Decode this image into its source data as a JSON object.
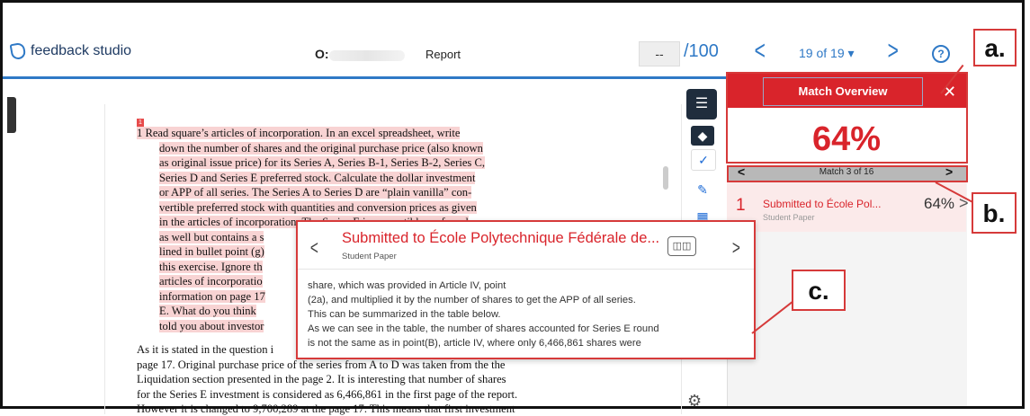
{
  "header": {
    "app_name": "feedback studio",
    "student_initial": "O:",
    "report_label": "Report",
    "score_value": "--",
    "score_max": "/100",
    "pager": "19 of 19 ▾",
    "help_symbol": "?"
  },
  "document": {
    "lines": [
      {
        "text": "1   Read square’s articles of incorporation. In an excel spreadsheet, write",
        "hl": true
      },
      {
        "text": "down the number of shares and the original purchase price (also known",
        "hl": true
      },
      {
        "text": "as original issue price) for its Series A, Series B-1, Series B-2, Series C,",
        "hl": true
      },
      {
        "text": "Series D and Series E preferred stock. Calculate the dollar investment",
        "hl": true
      },
      {
        "text": "or APP of all series. The Series A to Series D are “plain vanilla” con-",
        "hl": true
      },
      {
        "text": "vertible preferred stock with quantities and conversion prices as given",
        "hl": true
      },
      {
        "text": "in the articles of incorporation. The Series E is convertible preferred",
        "hl": true
      },
      {
        "text": "as well but contains a s",
        "hl": true
      },
      {
        "text": "lined in bullet point (g)",
        "hl": true
      },
      {
        "text": "this exercise. Ignore th",
        "hl": true
      },
      {
        "text": "articles of incorporatio",
        "hl": true
      },
      {
        "text": "information on page 17",
        "hl": true
      },
      {
        "text": "E. What do you think",
        "hl": true
      },
      {
        "text": "told you about investor",
        "hl": true
      }
    ],
    "para2": [
      "As it is stated in the question i",
      "page 17. Original purchase price of the series from A to D was taken from the the",
      "Liquidation section presented in the page 2. It is interesting that number of shares",
      "for the Series E investment is considered as 6,466,861 in the first page of the report.",
      "However it is changed to 9,700,289 at the page 17. This means that first investment"
    ],
    "marker": "1"
  },
  "match_overview": {
    "title": "Match Overview",
    "close": "✕",
    "score": "64%",
    "match_nav": "Match 3 of 16",
    "source": {
      "number": "1",
      "name": "Submitted to École Pol...",
      "type": "Student Paper",
      "percent": "64%"
    }
  },
  "popup": {
    "title": "Submitted to École Polytechnique Fédérale de...",
    "subtitle": "Student Paper",
    "body": [
      "share, which was provided in Article IV, point",
      "(2a), and multiplied it by the number of shares to get the APP of all series.",
      "This can be summarized in the table below.",
      "As we can see in the table, the number of shares accounted for Series E round",
      "is not the same as in point(B), article IV, where only 6,466,861 shares were"
    ]
  },
  "annotations": {
    "a": "a.",
    "b": "b.",
    "c": "c."
  },
  "colors": {
    "accent_blue": "#2f79c6",
    "match_red": "#d9242b",
    "highlight": "#f8d3d3"
  }
}
